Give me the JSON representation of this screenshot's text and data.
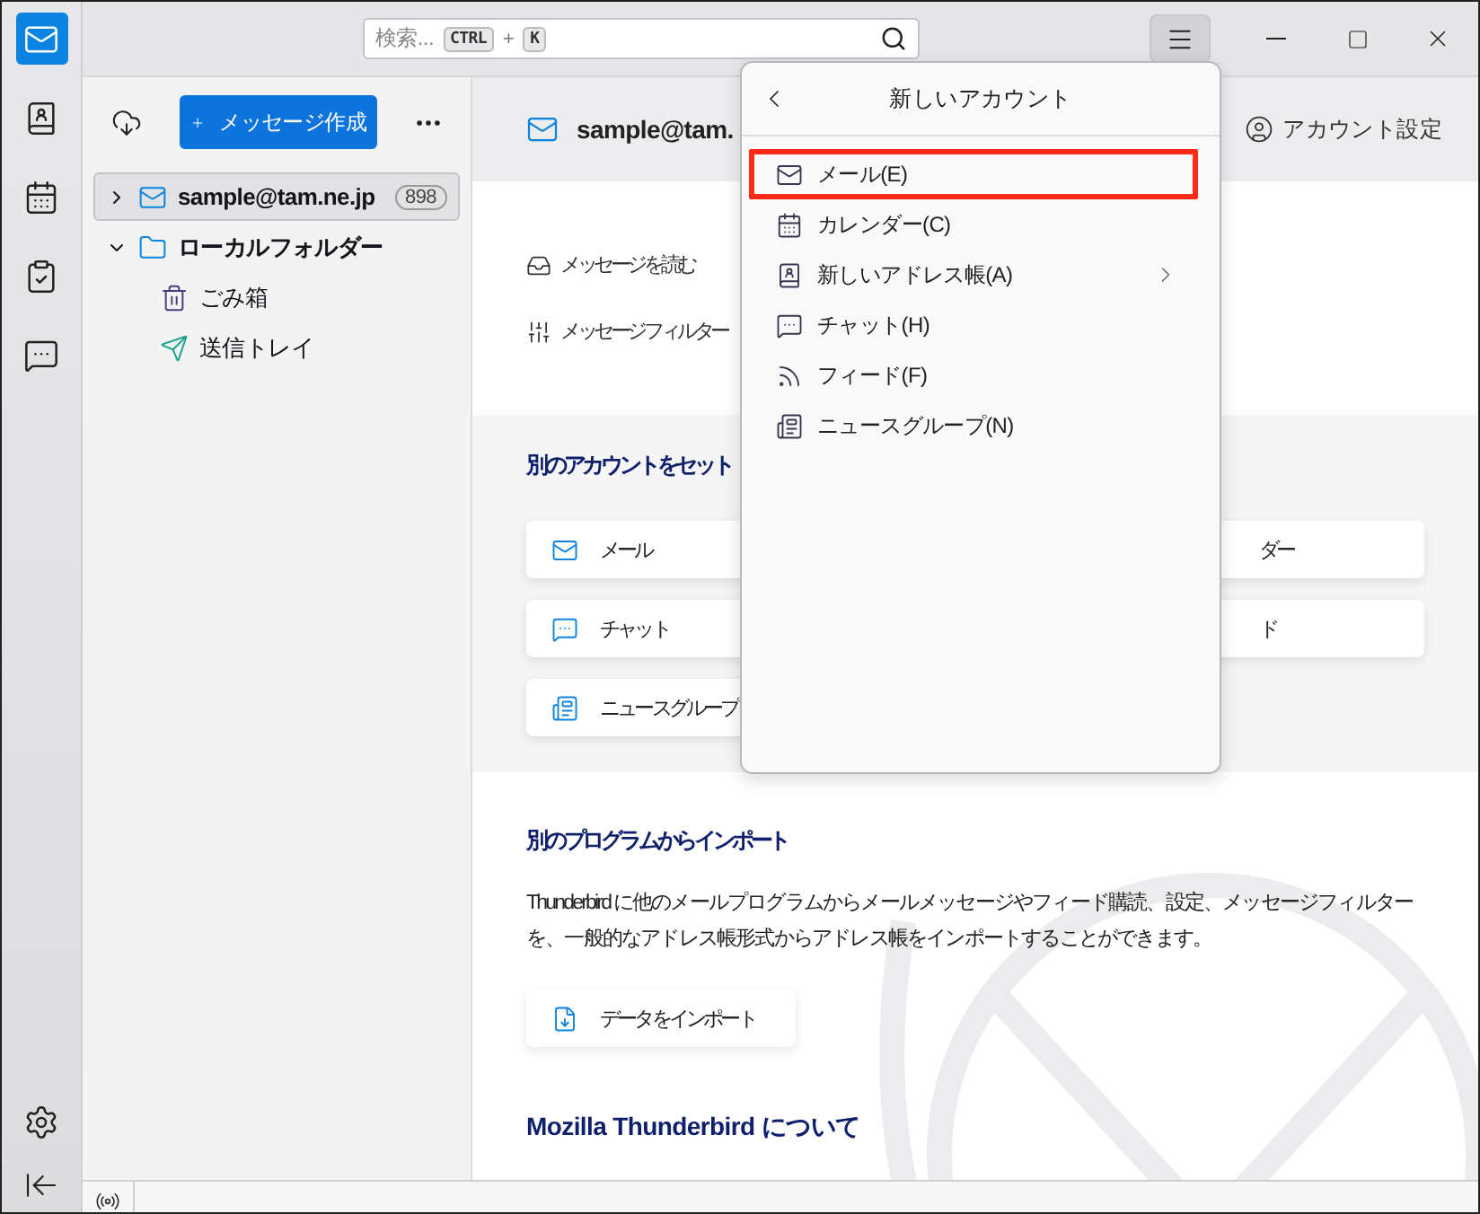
{
  "spaces_bar": {
    "items": [
      {
        "kind": "mail",
        "selected": true
      },
      {
        "kind": "addressbook",
        "selected": false
      },
      {
        "kind": "calendar",
        "selected": false
      },
      {
        "kind": "tasks",
        "selected": false
      },
      {
        "kind": "chat",
        "selected": false
      }
    ]
  },
  "search": {
    "placeholder": "検索...",
    "keys": [
      "CTRL",
      "K"
    ],
    "plus": "+"
  },
  "menu_button": {
    "active": true
  },
  "folder_pane": {
    "compose_button": "メッセージ作成",
    "folders": [
      {
        "kind": "account",
        "name": "sample@tam.ne.jp",
        "badge": "898",
        "selected": true,
        "expanded": false
      },
      {
        "kind": "local",
        "name": "ローカルフォルダー",
        "selected": false,
        "expanded": true,
        "children": [
          {
            "kind": "trash",
            "name": "ごみ箱",
            "selected": false
          },
          {
            "kind": "outbox",
            "name": "送信トレイ",
            "selected": false
          }
        ]
      }
    ]
  },
  "account_header": {
    "email": "sample@tam.",
    "settings": "アカウント設定"
  },
  "actions": [
    {
      "kind": "read",
      "label": "メッセージを読む"
    },
    {
      "kind": "filter",
      "label": "メッセージフィルター"
    }
  ],
  "setup_section": {
    "heading": "別のアカウントをセット",
    "cards": [
      {
        "kind": "mail",
        "label": "メール"
      },
      {
        "kind": "none",
        "label": "ダー"
      },
      {
        "kind": "chat",
        "label": "チャット"
      },
      {
        "kind": "none",
        "label": "ド"
      },
      {
        "kind": "newsgroup",
        "label": "ニュースグループ"
      }
    ]
  },
  "import_section": {
    "heading": "別のプログラムからインポート",
    "text": "Thunderbird に他のメールプログラムからメールメッセージやフィード購読、設定、メッセージフィルターを、一般的なアドレス帳形式からアドレス帳をインポートすることができます。",
    "button": "データをインポート"
  },
  "about_heading": "Mozilla Thunderbird について",
  "menu": {
    "title": "新しいアカウント",
    "items": [
      {
        "kind": "mail",
        "label": "メール(E)",
        "highlighted": true,
        "submenu": false
      },
      {
        "kind": "calendar",
        "label": "カレンダー(C)",
        "highlighted": false,
        "submenu": false
      },
      {
        "kind": "addressbook",
        "label": "新しいアドレス帳(A)",
        "highlighted": false,
        "submenu": true
      },
      {
        "kind": "chat",
        "label": "チャット(H)",
        "highlighted": false,
        "submenu": false
      },
      {
        "kind": "feed",
        "label": "フィード(F)",
        "highlighted": false,
        "submenu": false
      },
      {
        "kind": "newsgroup",
        "label": "ニュースグループ(N)",
        "highlighted": false,
        "submenu": false
      }
    ]
  }
}
